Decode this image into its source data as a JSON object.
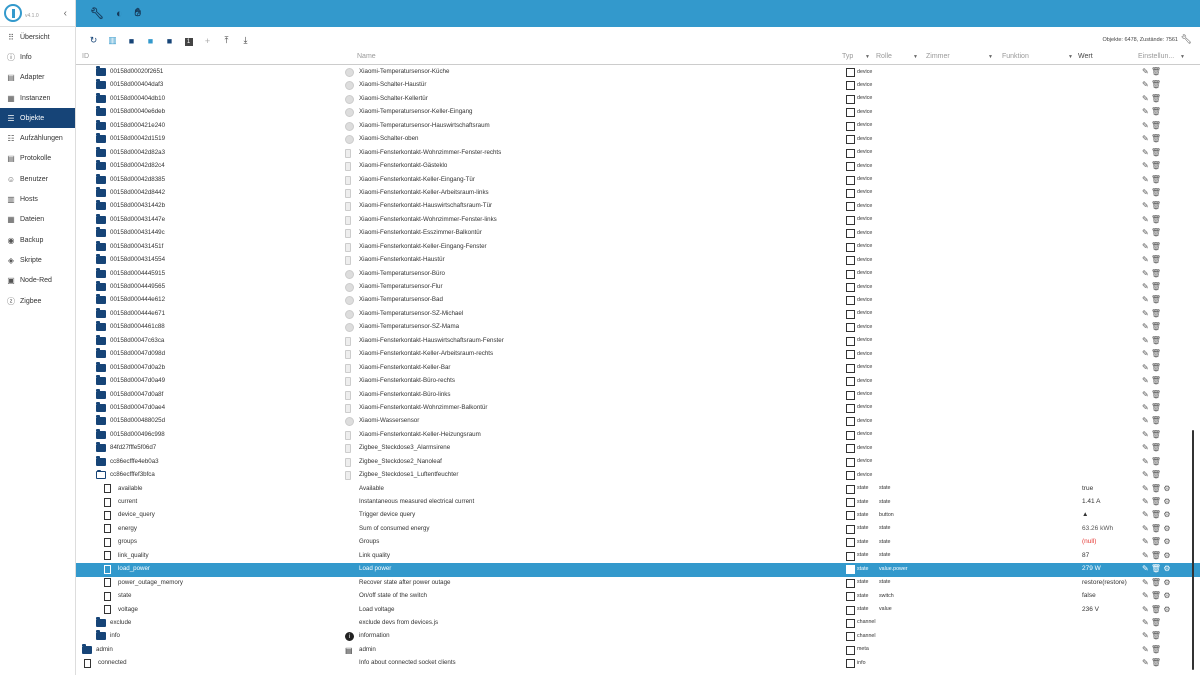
{
  "app": {
    "version": "v4.1.0"
  },
  "nav": [
    {
      "label": "Übersicht",
      "icon": "grid-icon",
      "glyph": "⠿"
    },
    {
      "label": "Info",
      "icon": "info-icon",
      "glyph": "ⓘ"
    },
    {
      "label": "Adapter",
      "icon": "store-icon",
      "glyph": "▤"
    },
    {
      "label": "Instanzen",
      "icon": "instances-icon",
      "glyph": "▦"
    },
    {
      "label": "Objekte",
      "icon": "list-icon",
      "glyph": "☰",
      "active": true
    },
    {
      "label": "Aufzählungen",
      "icon": "enum-icon",
      "glyph": "☷"
    },
    {
      "label": "Protokolle",
      "icon": "log-icon",
      "glyph": "▤"
    },
    {
      "label": "Benutzer",
      "icon": "user-icon",
      "glyph": "☺"
    },
    {
      "label": "Hosts",
      "icon": "host-icon",
      "glyph": "▥"
    },
    {
      "label": "Dateien",
      "icon": "files-icon",
      "glyph": "▦"
    },
    {
      "label": "Backup",
      "icon": "backup-icon",
      "glyph": "◉"
    },
    {
      "label": "Skripte",
      "icon": "script-icon",
      "glyph": "◈"
    },
    {
      "label": "Node-Red",
      "icon": "nodered-icon",
      "glyph": "▣"
    },
    {
      "label": "Zigbee",
      "icon": "zigbee-icon",
      "glyph": "ⓩ"
    }
  ],
  "topbar": {
    "icons": [
      "wrench-icon",
      "brightness-icon",
      "expert-mode-icon"
    ]
  },
  "toolbar": {
    "stats": "Objekte: 6478, Zustände: 7561"
  },
  "columns": {
    "id": "ID",
    "name": "Name",
    "type": "Typ",
    "role": "Rolle",
    "room": "Zimmer",
    "function": "Funktion",
    "value": "Wert",
    "settings": "Einstellun..."
  },
  "rows": [
    {
      "id": "00158d00020f2651",
      "name": "Xiaomi-Temperatursensor-Küche",
      "type": "device",
      "indent": 1,
      "kind": "folder",
      "nicon": "round"
    },
    {
      "id": "00158d000404daf3",
      "name": "Xiaomi-Schalter-Haustür",
      "type": "device",
      "indent": 1,
      "kind": "folder",
      "nicon": "round"
    },
    {
      "id": "00158d000404db10",
      "name": "Xiaomi-Schalter-Kellertür",
      "type": "device",
      "indent": 1,
      "kind": "folder",
      "nicon": "round"
    },
    {
      "id": "00158d00040e6deb",
      "name": "Xiaomi-Temperatursensor-Keller-Eingang",
      "type": "device",
      "indent": 1,
      "kind": "folder",
      "nicon": "round"
    },
    {
      "id": "00158d000421e240",
      "name": "Xiaomi-Temperatursensor-Hauswirtschaftsraum",
      "type": "device",
      "indent": 1,
      "kind": "folder",
      "nicon": "round"
    },
    {
      "id": "00158d00042d1519",
      "name": "Xiaomi-Schalter-oben",
      "type": "device",
      "indent": 1,
      "kind": "folder",
      "nicon": "round"
    },
    {
      "id": "00158d00042d82a3",
      "name": "Xiaomi-Fensterkontakt-Wohnzimmer-Fenster-rechts",
      "type": "device",
      "indent": 1,
      "kind": "folder",
      "nicon": "rect"
    },
    {
      "id": "00158d00042d82c4",
      "name": "Xiaomi-Fensterkontakt-Gästeklo",
      "type": "device",
      "indent": 1,
      "kind": "folder",
      "nicon": "rect"
    },
    {
      "id": "00158d00042d8385",
      "name": "Xiaomi-Fensterkontakt-Keller-Eingang-Tür",
      "type": "device",
      "indent": 1,
      "kind": "folder",
      "nicon": "rect"
    },
    {
      "id": "00158d00042d8442",
      "name": "Xiaomi-Fensterkontakt-Keller-Arbeitsraum-links",
      "type": "device",
      "indent": 1,
      "kind": "folder",
      "nicon": "rect"
    },
    {
      "id": "00158d000431442b",
      "name": "Xiaomi-Fensterkontakt-Hauswirtschaftsraum-Tür",
      "type": "device",
      "indent": 1,
      "kind": "folder",
      "nicon": "rect"
    },
    {
      "id": "00158d000431447e",
      "name": "Xiaomi-Fensterkontakt-Wohnzimmer-Fenster-links",
      "type": "device",
      "indent": 1,
      "kind": "folder",
      "nicon": "rect"
    },
    {
      "id": "00158d000431449c",
      "name": "Xiaomi-Fensterkontakt-Esszimmer-Balkontür",
      "type": "device",
      "indent": 1,
      "kind": "folder",
      "nicon": "rect"
    },
    {
      "id": "00158d000431451f",
      "name": "Xiaomi-Fensterkontakt-Keller-Eingang-Fenster",
      "type": "device",
      "indent": 1,
      "kind": "folder",
      "nicon": "rect"
    },
    {
      "id": "00158d0004314554",
      "name": "Xiaomi-Fensterkontakt-Haustür",
      "type": "device",
      "indent": 1,
      "kind": "folder",
      "nicon": "rect"
    },
    {
      "id": "00158d0004445915",
      "name": "Xiaomi-Temperatursensor-Büro",
      "type": "device",
      "indent": 1,
      "kind": "folder",
      "nicon": "round"
    },
    {
      "id": "00158d0004449565",
      "name": "Xiaomi-Temperatursensor-Flur",
      "type": "device",
      "indent": 1,
      "kind": "folder",
      "nicon": "round"
    },
    {
      "id": "00158d000444e612",
      "name": "Xiaomi-Temperatursensor-Bad",
      "type": "device",
      "indent": 1,
      "kind": "folder",
      "nicon": "round"
    },
    {
      "id": "00158d000444e671",
      "name": "Xiaomi-Temperatursensor-SZ-Michael",
      "type": "device",
      "indent": 1,
      "kind": "folder",
      "nicon": "round"
    },
    {
      "id": "00158d0004461c88",
      "name": "Xiaomi-Temperatursensor-SZ-Mama",
      "type": "device",
      "indent": 1,
      "kind": "folder",
      "nicon": "round"
    },
    {
      "id": "00158d00047c63ca",
      "name": "Xiaomi-Fensterkontakt-Hauswirtschaftsraum-Fenster",
      "type": "device",
      "indent": 1,
      "kind": "folder",
      "nicon": "rect"
    },
    {
      "id": "00158d00047d098d",
      "name": "Xiaomi-Fensterkontakt-Keller-Arbeitsraum-rechts",
      "type": "device",
      "indent": 1,
      "kind": "folder",
      "nicon": "rect"
    },
    {
      "id": "00158d00047d0a2b",
      "name": "Xiaomi-Fensterkontakt-Keller-Bar",
      "type": "device",
      "indent": 1,
      "kind": "folder",
      "nicon": "rect"
    },
    {
      "id": "00158d00047d0a49",
      "name": "Xiaomi-Fensterkontakt-Büro-rechts",
      "type": "device",
      "indent": 1,
      "kind": "folder",
      "nicon": "rect"
    },
    {
      "id": "00158d00047d0a8f",
      "name": "Xiaomi-Fensterkontakt-Büro-links",
      "type": "device",
      "indent": 1,
      "kind": "folder",
      "nicon": "rect"
    },
    {
      "id": "00158d00047d0ae4",
      "name": "Xiaomi-Fensterkontakt-Wohnzimmer-Balkontür",
      "type": "device",
      "indent": 1,
      "kind": "folder",
      "nicon": "rect"
    },
    {
      "id": "00158d000488025d",
      "name": "Xiaomi-Wassersensor",
      "type": "device",
      "indent": 1,
      "kind": "folder",
      "nicon": "round"
    },
    {
      "id": "00158d000496c998",
      "name": "Xiaomi-Fensterkontakt-Keller-Heizungsraum",
      "type": "device",
      "indent": 1,
      "kind": "folder",
      "nicon": "rect"
    },
    {
      "id": "84fd27fffe5f06d7",
      "name": "Zigbee_Steckdose3_Alarmsirene",
      "type": "device",
      "indent": 1,
      "kind": "folder",
      "nicon": "rect"
    },
    {
      "id": "cc86ecfffe4eb0a3",
      "name": "Zigbee_Steckdose2_Nanoleaf",
      "type": "device",
      "indent": 1,
      "kind": "folder",
      "nicon": "rect"
    },
    {
      "id": "cc86ecfffef3bfca",
      "name": "Zigbee_Steckdose1_Luftentfeuchter",
      "type": "device",
      "indent": 1,
      "kind": "folder-open",
      "nicon": "rect"
    },
    {
      "id": "available",
      "name": "Available",
      "type": "state",
      "role": "state",
      "value": "true",
      "indent": 2,
      "kind": "file",
      "gear": true
    },
    {
      "id": "current",
      "name": "Instantaneous measured electrical current",
      "type": "state",
      "role": "state",
      "value": "1.41 A",
      "indent": 2,
      "kind": "file",
      "gear": true
    },
    {
      "id": "device_query",
      "name": "Trigger device query",
      "type": "state",
      "role": "button",
      "value": "▲",
      "indent": 2,
      "kind": "file",
      "gear": true
    },
    {
      "id": "energy",
      "name": "Sum of consumed energy",
      "type": "state",
      "role": "state",
      "value": "63.26 kWh",
      "indent": 2,
      "kind": "file",
      "gear": true,
      "vclass": "mute"
    },
    {
      "id": "groups",
      "name": "Groups",
      "type": "state",
      "role": "state",
      "value": "(null)",
      "indent": 2,
      "kind": "file",
      "gear": true,
      "vclass": "null"
    },
    {
      "id": "link_quality",
      "name": "Link quality",
      "type": "state",
      "role": "state",
      "value": "87",
      "indent": 2,
      "kind": "file",
      "gear": true
    },
    {
      "id": "load_power",
      "name": "Load power",
      "type": "state",
      "role": "value.power",
      "value": "279 W",
      "indent": 2,
      "kind": "file",
      "gear": true,
      "selected": true
    },
    {
      "id": "power_outage_memory",
      "name": "Recover state after power outage",
      "type": "state",
      "role": "state",
      "value": "restore(restore)",
      "indent": 2,
      "kind": "file",
      "gear": true
    },
    {
      "id": "state",
      "name": "On/off state of the switch",
      "type": "state",
      "role": "switch",
      "value": "false",
      "indent": 2,
      "kind": "file",
      "gear": true
    },
    {
      "id": "voltage",
      "name": "Load voltage",
      "type": "state",
      "role": "value",
      "value": "236 V",
      "indent": 2,
      "kind": "file",
      "gear": true
    },
    {
      "id": "exclude",
      "name": "exclude devs from devices.js",
      "type": "channel",
      "indent": 1,
      "kind": "folder"
    },
    {
      "id": "info",
      "name": "information",
      "type": "channel",
      "indent": 1,
      "kind": "folder",
      "nicon": "info"
    },
    {
      "id": "admin",
      "name": "admin",
      "type": "meta",
      "indent": 0,
      "kind": "folder",
      "nicon": "doc"
    },
    {
      "id": "connected",
      "name": "Info about connected socket clients",
      "type": "info",
      "indent": -1,
      "kind": "file"
    }
  ],
  "colors": {
    "primary": "#3399cc",
    "nav_active": "#164477",
    "null_value": "#e53935"
  }
}
